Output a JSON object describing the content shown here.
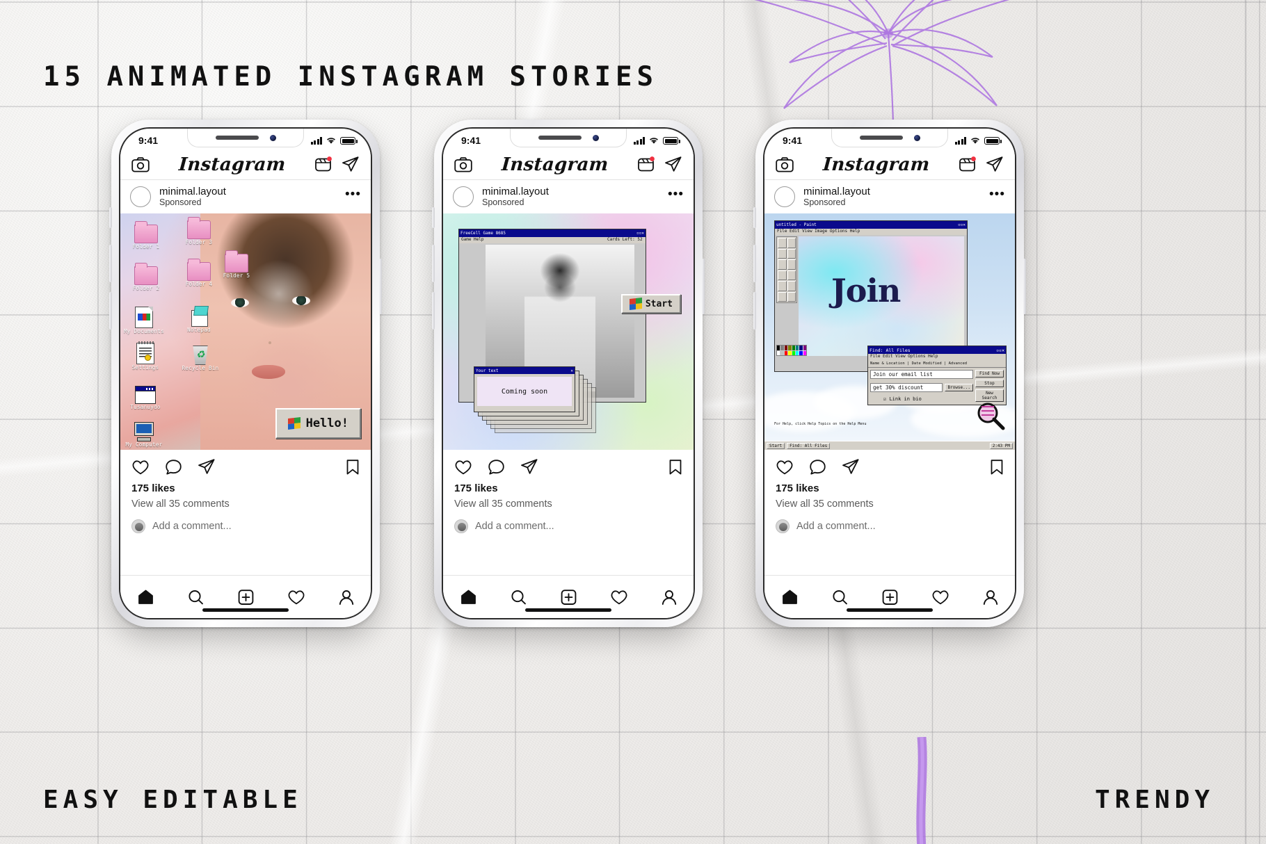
{
  "page": {
    "title_main": "15 ANIMATED INSTAGRAM STORIES",
    "label_left": "EASY EDITABLE",
    "label_right": "TRENDY",
    "background_color": "#f2f0ee",
    "accent_color": "#a86ce0"
  },
  "phones": [
    {
      "id": "phone-1",
      "status": {
        "time": "9:41",
        "signal_icon": "signal-bars-icon",
        "wifi_icon": "wifi-icon",
        "battery_icon": "battery-full-icon"
      },
      "topbar": {
        "camera_icon": "camera-icon",
        "logo": "Instagram",
        "reels_icon": "reels-icon",
        "messenger_icon": "paper-plane-icon"
      },
      "post": {
        "username": "minimal.layout",
        "subtitle": "Sponsored",
        "more_icon": "more-options-icon",
        "likes": "175 likes",
        "comments": "View all 35 comments",
        "add_comment_placeholder": "Add a comment...",
        "like_icon": "heart-icon",
        "comment_icon": "comment-bubble-icon",
        "share_icon": "paper-plane-icon",
        "save_icon": "bookmark-icon"
      },
      "media": {
        "kind": "win95-desktop",
        "desktop_icons": [
          {
            "label": "Folder 1",
            "icon": "folder-icon"
          },
          {
            "label": "Folder 2",
            "icon": "folder-icon"
          },
          {
            "label": "Folder 3",
            "icon": "folder-icon"
          },
          {
            "label": "Folder 4",
            "icon": "folder-icon"
          },
          {
            "label": "Folder 5",
            "icon": "folder-icon"
          },
          {
            "label": "My Documents",
            "icon": "document-icon"
          },
          {
            "label": "Notepad",
            "icon": "notepad-icon"
          },
          {
            "label": "Settings",
            "icon": "settings-icon"
          },
          {
            "label": "Recycle Bin",
            "icon": "recycle-bin-icon"
          },
          {
            "label": "Tusanuydo",
            "icon": "window-icon"
          },
          {
            "label": "My Computer",
            "icon": "my-computer-icon"
          }
        ],
        "dialog": {
          "text": "Hello!",
          "icon": "windows-flag-icon"
        }
      },
      "nav": [
        "home-icon",
        "search-icon",
        "add-post-icon",
        "activity-heart-icon",
        "profile-icon"
      ]
    },
    {
      "id": "phone-2",
      "status": {
        "time": "9:41",
        "signal_icon": "signal-bars-icon",
        "wifi_icon": "wifi-icon",
        "battery_icon": "battery-full-icon"
      },
      "topbar": {
        "camera_icon": "camera-icon",
        "logo": "Instagram",
        "reels_icon": "reels-icon",
        "messenger_icon": "paper-plane-icon"
      },
      "post": {
        "username": "minimal.layout",
        "subtitle": "Sponsored",
        "more_icon": "more-options-icon",
        "likes": "175 likes",
        "comments": "View all 35 comments",
        "add_comment_placeholder": "Add a comment...",
        "like_icon": "heart-icon",
        "comment_icon": "comment-bubble-icon",
        "share_icon": "paper-plane-icon",
        "save_icon": "bookmark-icon"
      },
      "media": {
        "kind": "freecell-window",
        "window_title": "FreeCell Game 8685",
        "window_menu": "Game   Help",
        "window_status": "Cards Left: 52",
        "dialog_title": "Your text",
        "dialog_body": "Coming soon",
        "start_button": "Start",
        "start_icon": "windows-flag-icon"
      },
      "nav": [
        "home-icon",
        "search-icon",
        "add-post-icon",
        "activity-heart-icon",
        "profile-icon"
      ]
    },
    {
      "id": "phone-3",
      "status": {
        "time": "9:41",
        "signal_icon": "signal-bars-icon",
        "wifi_icon": "wifi-icon",
        "battery_icon": "battery-full-icon"
      },
      "topbar": {
        "camera_icon": "camera-icon",
        "logo": "Instagram",
        "reels_icon": "reels-icon",
        "messenger_icon": "paper-plane-icon"
      },
      "post": {
        "username": "minimal.layout",
        "subtitle": "Sponsored",
        "more_icon": "more-options-icon",
        "likes": "175 likes",
        "comments": "View all 35 comments",
        "add_comment_placeholder": "Add a comment...",
        "like_icon": "heart-icon",
        "comment_icon": "comment-bubble-icon",
        "share_icon": "paper-plane-icon",
        "save_icon": "bookmark-icon"
      },
      "media": {
        "kind": "paint-window",
        "paint_title": "untitled - Paint",
        "paint_menu": "File  Edit  View  Image  Options  Help",
        "canvas_text": "Join",
        "find_title": "Find: All Files",
        "find_menu": "File   Edit   View   Options   Help",
        "find_tabs": "Name & Location | Date Modified | Advanced",
        "find_field_1": "Join our email list",
        "find_field_2": "get 30% discount",
        "find_checkbox": "Link in bio",
        "find_buttons": [
          "Find Now",
          "Stop",
          "New Search"
        ],
        "browse_button": "Browse...",
        "find_help": "For Help, click Help Topics on the Help Menu",
        "magnifier_icon": "magnifier-icon",
        "taskbar_start": "Start",
        "taskbar_item": "Find: All Files",
        "taskbar_time": "2:43 PM"
      },
      "nav": [
        "home-icon",
        "search-icon",
        "add-post-icon",
        "activity-heart-icon",
        "profile-icon"
      ]
    }
  ]
}
